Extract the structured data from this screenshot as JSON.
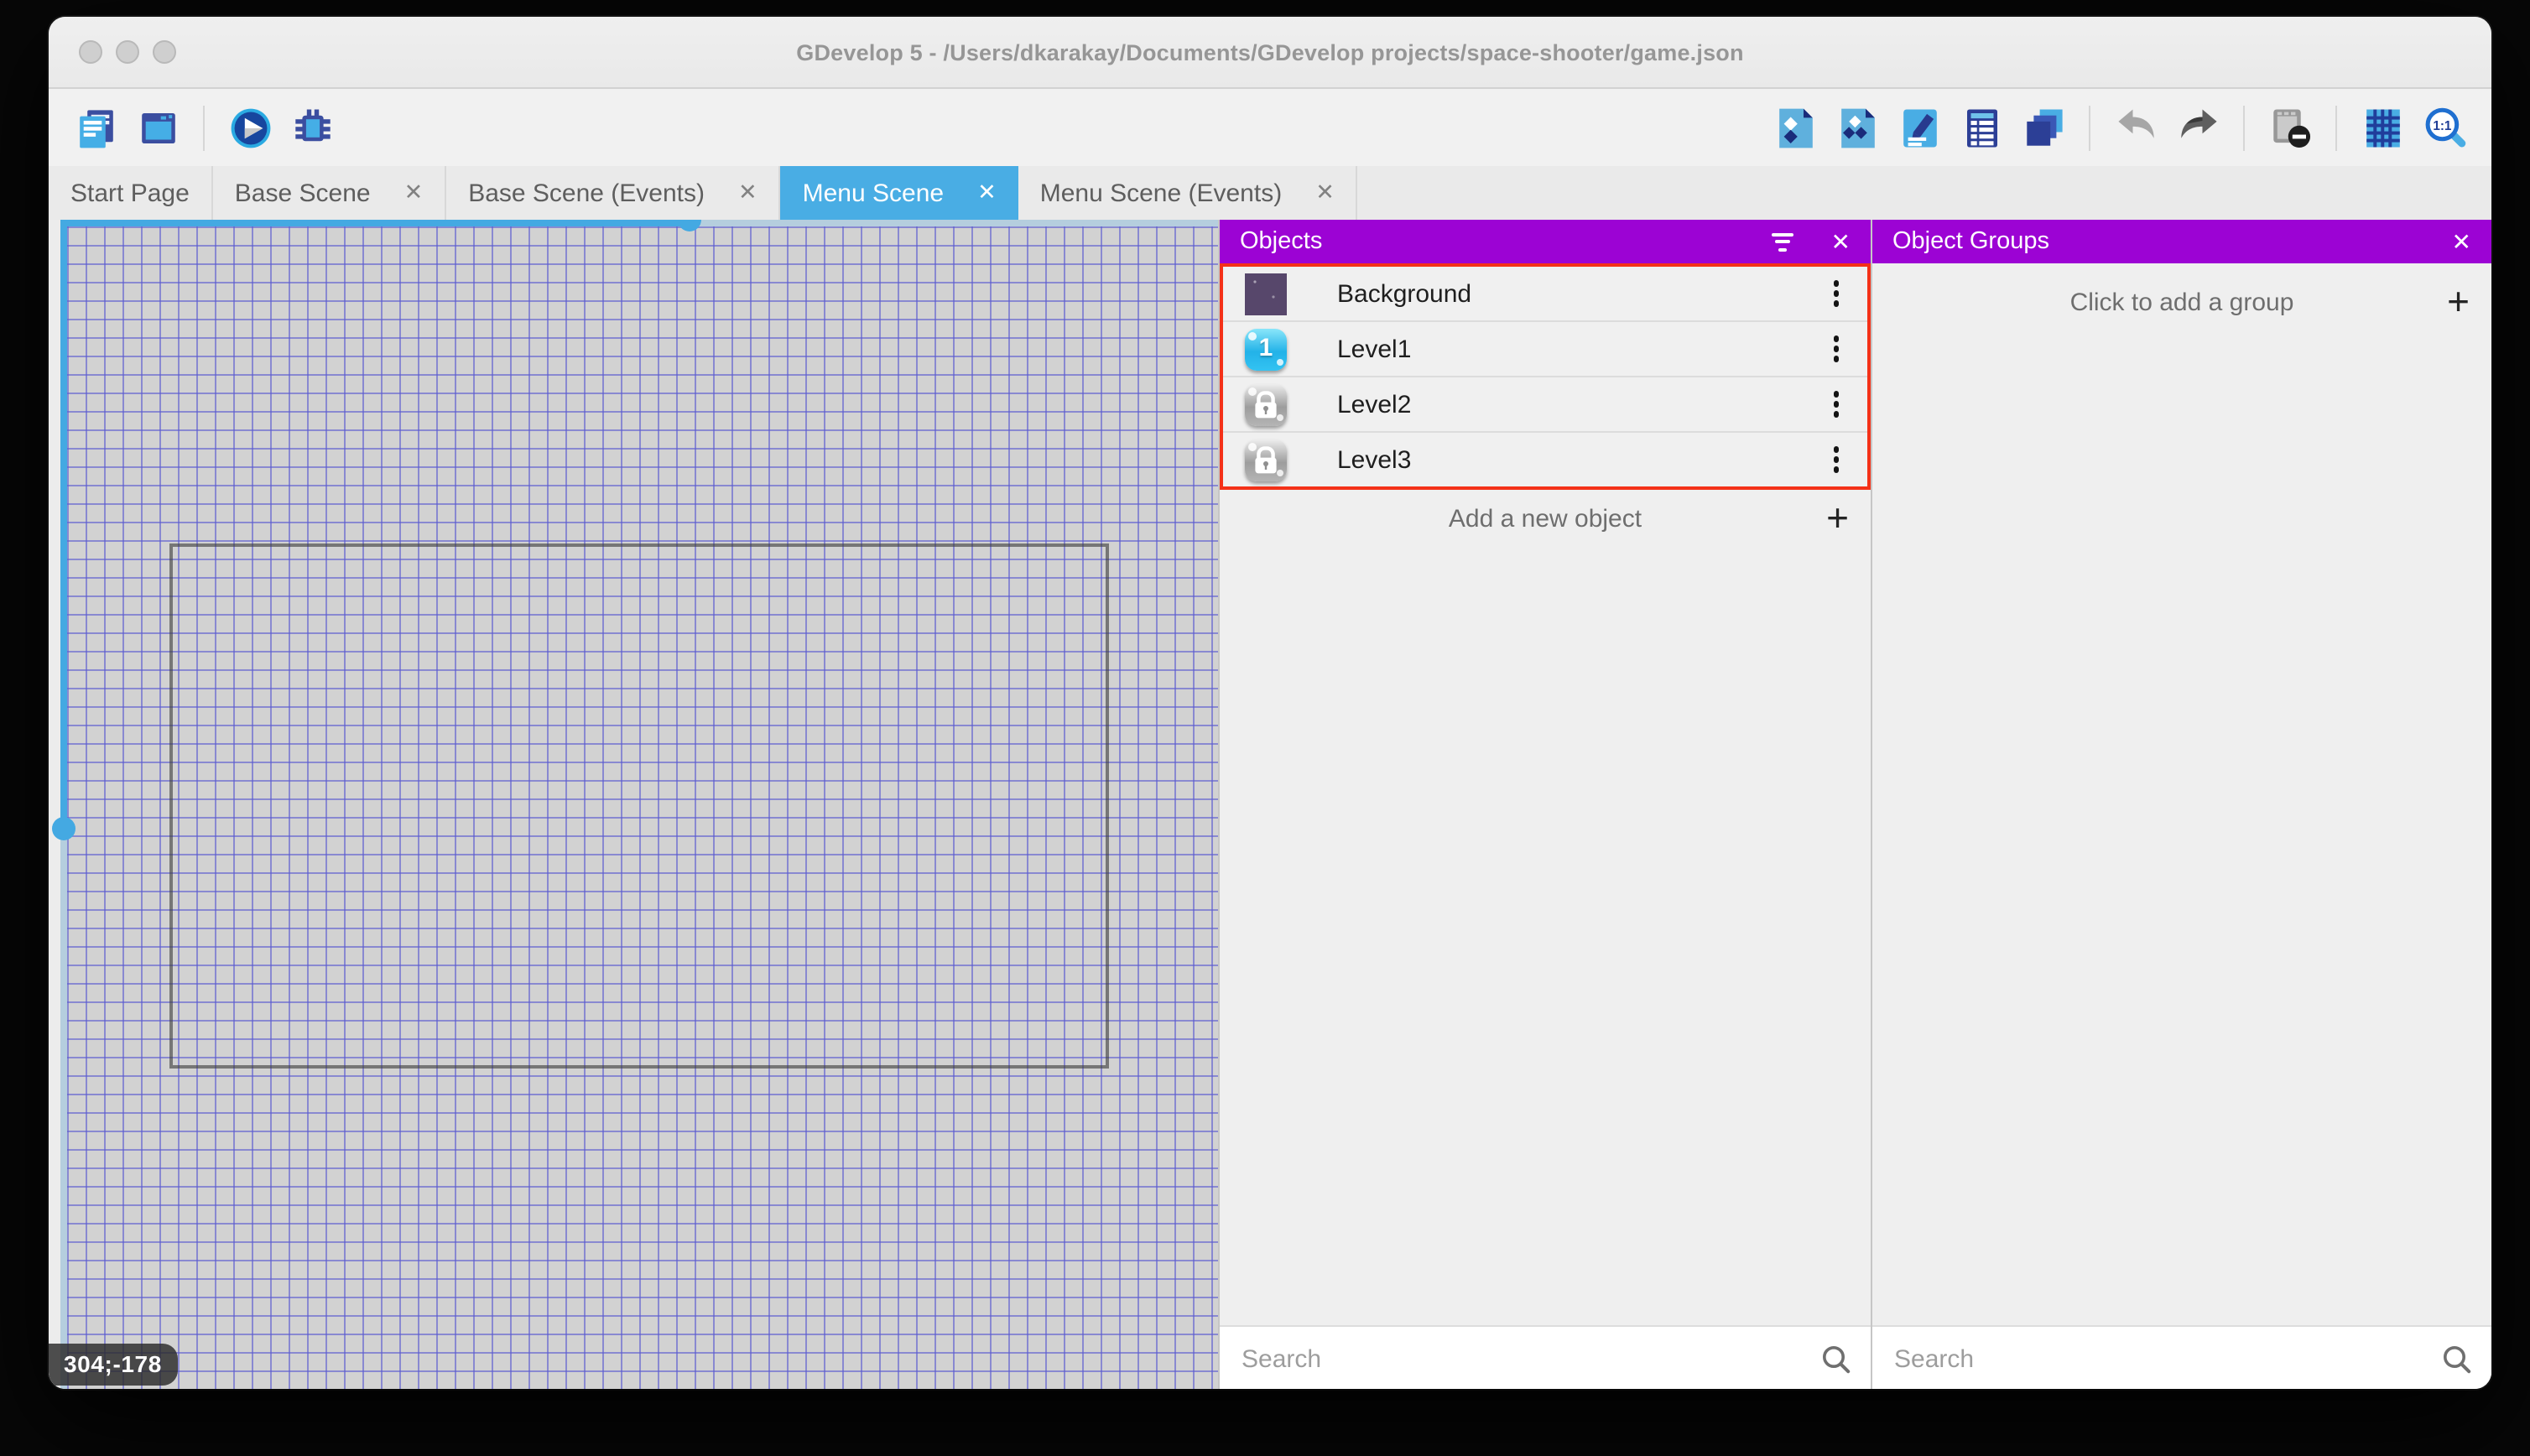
{
  "window": {
    "title": "GDevelop 5 - /Users/dkarakay/Documents/GDevelop projects/space-shooter/game.json"
  },
  "toolbar": {
    "left_icons": [
      "project-manager",
      "preview-window",
      "play",
      "debug"
    ],
    "right_icons": [
      "objects",
      "object-groups",
      "properties",
      "instances-list",
      "layers",
      "undo",
      "redo",
      "preview-mask",
      "grid",
      "zoom-1-1"
    ]
  },
  "tabs": [
    {
      "label": "Start Page",
      "closable": false,
      "active": false
    },
    {
      "label": "Base Scene",
      "closable": true,
      "active": false
    },
    {
      "label": "Base Scene (Events)",
      "closable": true,
      "active": false
    },
    {
      "label": "Menu Scene",
      "closable": true,
      "active": true
    },
    {
      "label": "Menu Scene (Events)",
      "closable": true,
      "active": false
    }
  ],
  "canvas": {
    "coordinates": "304;-178"
  },
  "objects_panel": {
    "title": "Objects",
    "items": [
      {
        "name": "Background",
        "icon": "background-thumbnail"
      },
      {
        "name": "Level1",
        "icon": "level1-button"
      },
      {
        "name": "Level2",
        "icon": "locked-button"
      },
      {
        "name": "Level3",
        "icon": "locked-button"
      }
    ],
    "add_label": "Add a new object",
    "search_placeholder": "Search"
  },
  "object_groups_panel": {
    "title": "Object Groups",
    "empty_label": "Click to add a group",
    "search_placeholder": "Search"
  },
  "icons": {
    "close_glyph": "✕",
    "plus_glyph": "+",
    "zoom_label": "1:1",
    "level1_digit": "1"
  },
  "colors": {
    "panel_header_purple": "#9c03d4",
    "active_tab_blue": "#49ade4",
    "highlight_red": "#f43118",
    "grid_line": "#5c5cd0",
    "canvas_bg": "#d2d2d2"
  }
}
